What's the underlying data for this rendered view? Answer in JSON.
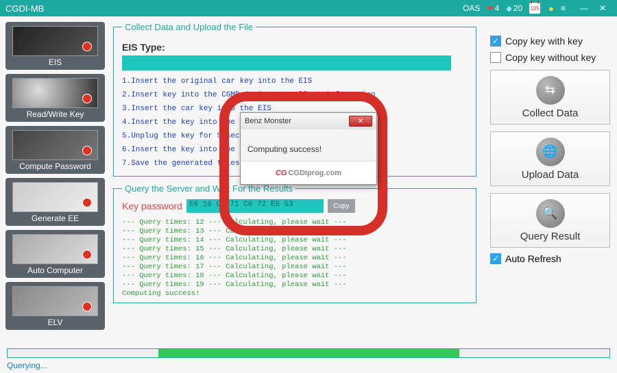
{
  "titlebar": {
    "title": "CGDI-MB",
    "oas": "OAS",
    "hearts": "4",
    "diamonds": "20",
    "calendar": "105"
  },
  "sidebar": {
    "items": [
      {
        "label": "EIS"
      },
      {
        "label": "Read/Write Key"
      },
      {
        "label": "Compute Password"
      },
      {
        "label": "Generate EE"
      },
      {
        "label": "Auto Computer"
      },
      {
        "label": "ELV"
      }
    ]
  },
  "center": {
    "collect_legend": "Collect Data and Upload the File",
    "eis_type_label": "EIS Type:",
    "eis_type_value": "",
    "steps": "1.Insert the original car key into the EIS\n2.Insert key into the CGMB device to collect information\n3.Insert the car key into the EIS\n4.Insert the key into the EIS\n5.Unplug the key for 5 seconds and re-insert it into EIS\n6.Insert the key into the CGMB device\n7.Save the generated files",
    "query_legend": "Query the Server and Wait For the Results",
    "pw_label": "Key password",
    "pw_value": "E6 10 CC 71 C0 72 E6 53",
    "copy": "Copy",
    "log": "--- Query times: 12 --- Calculating, please wait ---\n--- Query times: 13 --- Calculating, please wait ---\n--- Query times: 14 --- Calculating, please wait ---\n--- Query times: 15 --- Calculating, please wait ---\n--- Query times: 16 --- Calculating, please wait ---\n--- Query times: 17 --- Calculating, please wait ---\n--- Query times: 18 --- Calculating, please wait ---\n--- Query times: 19 --- Calculating, please wait ---\nComputing success!"
  },
  "right": {
    "opt_with": "Copy key with key",
    "opt_without": "Copy key without key",
    "btn_collect": "Collect Data",
    "btn_upload": "Upload  Data",
    "btn_query": "Query Result",
    "auto_refresh": "Auto Refresh"
  },
  "status": "Querying...",
  "dialog": {
    "title": "Benz Monster",
    "message": "Computing success!",
    "logo_cg": "CG",
    "logo_rest": "CGDIprog.com"
  }
}
